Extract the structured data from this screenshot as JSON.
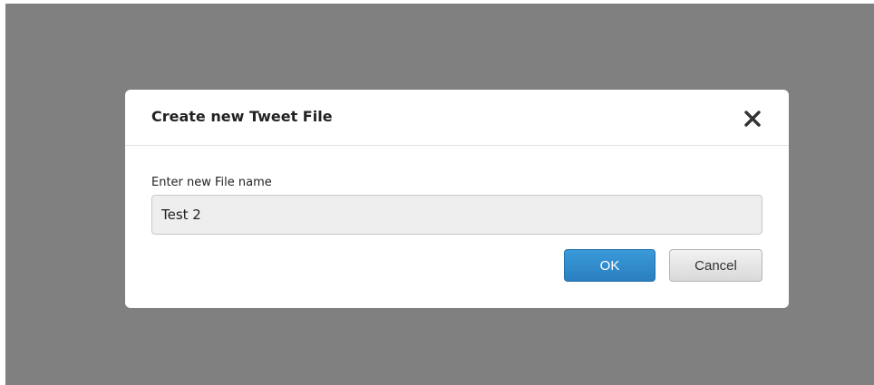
{
  "dialog": {
    "title": "Create new Tweet File",
    "close_icon": "close-icon",
    "field_label": "Enter new File name",
    "file_name_value": "Test 2",
    "ok_label": "OK",
    "cancel_label": "Cancel"
  },
  "colors": {
    "overlay": "#808080",
    "ok_button": "#2a88cc",
    "cancel_button": "#e5e5e5"
  }
}
